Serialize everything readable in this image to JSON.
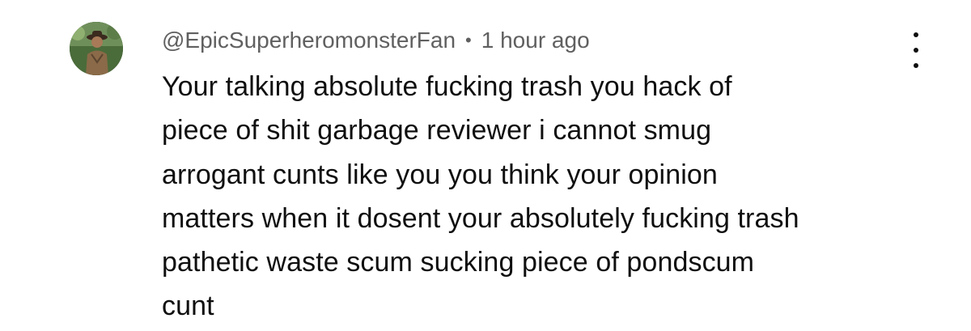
{
  "comment": {
    "author": "@EpicSuperheromonsterFan",
    "separator": "•",
    "timestamp": "1 hour ago",
    "body_lines": [
      "Your talking absolute fucking trash you hack of",
      "piece of shit garbage reviewer i cannot smug",
      "arrogant cunts like you you think your opinion",
      "matters when it dosent your absolutely fucking trash",
      "pathetic waste scum sucking piece of pondscum",
      "cunt"
    ],
    "menu_icon": "vertical-ellipsis-icon",
    "avatar_icon": "user-avatar-photo"
  },
  "colors": {
    "author_meta": "#606060",
    "body_text": "#0f0f0f",
    "background": "#ffffff"
  }
}
